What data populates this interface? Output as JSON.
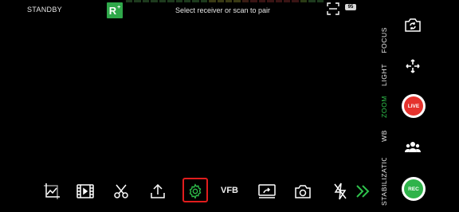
{
  "status": "STANDBY",
  "logo": {
    "letter": "R",
    "superscript": "+"
  },
  "pair_message": "Select receiver or scan to pair",
  "battery": "95",
  "right_panel": {
    "labels": {
      "focus": "FOCUS",
      "light": "LIGHT",
      "zoom": "ZOOM",
      "wb": "WB",
      "stabilization": "STABILIZATION"
    },
    "live_label": "LIVE",
    "rec_label": "REC"
  },
  "toolbar": {
    "vfb_label": "VFB"
  },
  "colors": {
    "accent_green": "#2fc24c",
    "live_red": "#e5322d",
    "highlight_red": "#e11d1d",
    "logo_green": "#2fa84a"
  },
  "icons": [
    "histogram-icon",
    "clip-icon",
    "scissors-icon",
    "upload-icon",
    "gear-icon",
    "screen-share-icon",
    "camera-icon",
    "flash-off-icon",
    "expand-arrows-icon",
    "camera-flip-icon",
    "gimbal-icon",
    "group-icon",
    "qr-scan-icon"
  ]
}
